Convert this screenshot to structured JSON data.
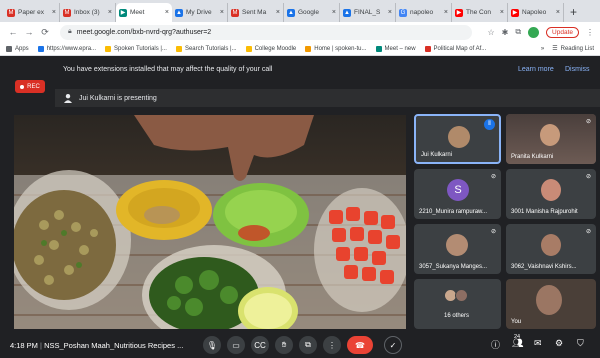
{
  "browser": {
    "tabs": [
      {
        "label": "Paper ex",
        "color": "#d93025",
        "glyph": "M"
      },
      {
        "label": "Inbox (3)",
        "color": "#d93025",
        "glyph": "M"
      },
      {
        "label": "Meet",
        "color": "#00897b",
        "glyph": "▶",
        "active": true
      },
      {
        "label": "My Drive",
        "color": "#1a73e8",
        "glyph": "▲"
      },
      {
        "label": "Sent Ma",
        "color": "#d93025",
        "glyph": "M"
      },
      {
        "label": "Google",
        "color": "#1a73e8",
        "glyph": "▲"
      },
      {
        "label": "FINAL_S",
        "color": "#1a73e8",
        "glyph": "▲"
      },
      {
        "label": "napoleo",
        "color": "#4285f4",
        "glyph": "G"
      },
      {
        "label": "The Con",
        "color": "#ff0000",
        "glyph": "▶"
      },
      {
        "label": "Napoleo",
        "color": "#ff0000",
        "glyph": "▶"
      }
    ],
    "new_tab": "+",
    "url": "meet.google.com/bxb-nvrd-qrg?authuser=2",
    "update_label": "Update",
    "bookmarks": [
      {
        "label": "Apps",
        "color": "#5f6368"
      },
      {
        "label": "https://www.epra...",
        "color": "#1a73e8"
      },
      {
        "label": "Spoken Tutorials |...",
        "color": "#fbbc04"
      },
      {
        "label": "Search Tutorials |...",
        "color": "#fbbc04"
      },
      {
        "label": "College Moodle",
        "color": "#fbbc04"
      },
      {
        "label": "Home | spoken-tu...",
        "color": "#f29900"
      },
      {
        "label": "Meet – new",
        "color": "#00897b"
      },
      {
        "label": "Political Map of Af...",
        "color": "#d93025"
      }
    ],
    "reading_list": "Reading List"
  },
  "meet": {
    "rec_label": "REC",
    "extension_message": "You have extensions installed that may affect the quality of your call",
    "learn_more": "Learn more",
    "dismiss": "Dismiss",
    "presenting": "Jui Kulkarni is presenting",
    "participants": [
      {
        "name": "Jui Kulkarni"
      },
      {
        "name": "Pranita Kulkarni"
      },
      {
        "name": "2210_Munira rampuraw...",
        "initial": "S"
      },
      {
        "name": "3001 Manisha Rajpurohit"
      },
      {
        "name": "3057_Sukanya Manges..."
      },
      {
        "name": "3062_Vaishnavi Kshirs..."
      },
      {
        "name": "16 others"
      },
      {
        "name": "You"
      }
    ],
    "time": "4:18 PM",
    "meeting_title": "NSS_Poshan Maah_Nutritious Recipes ...",
    "people_count": "24"
  },
  "colors": {
    "meet_bg": "#202124",
    "tile_bg": "#3c4043",
    "end_call": "#ea4335",
    "rec": "#d93025",
    "accent_link": "#8ab4f8",
    "avatar_purple": "#7e57c2"
  }
}
